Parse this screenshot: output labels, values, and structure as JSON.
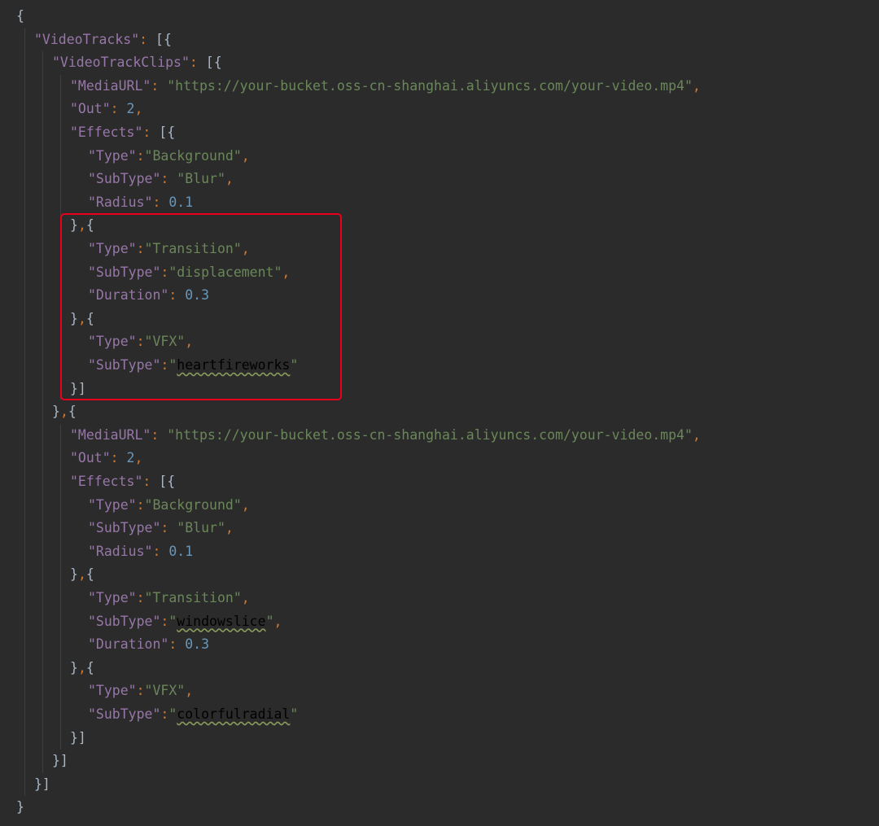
{
  "editor": {
    "highlight_color": "#e8001c",
    "colors": {
      "background": "#2b2b2b",
      "key": "#9876aa",
      "string": "#6a8759",
      "number": "#6897bb",
      "punctuation": "#cc7832",
      "bracket": "#a9b7c6"
    },
    "lines": [
      [
        [
          "brk",
          "{"
        ]
      ],
      [
        [
          "key",
          "\"VideoTracks\""
        ],
        [
          "pun",
          ":"
        ],
        [
          "brk",
          " [{"
        ]
      ],
      [
        [
          "key",
          "\"VideoTrackClips\""
        ],
        [
          "pun",
          ":"
        ],
        [
          "brk",
          " [{"
        ]
      ],
      [
        [
          "key",
          "\"MediaURL\""
        ],
        [
          "pun",
          ": "
        ],
        [
          "str",
          "\"https://your-bucket.oss-cn-shanghai.aliyuncs.com/your-video.mp4\""
        ],
        [
          "pun",
          ","
        ]
      ],
      [
        [
          "key",
          "\"Out\""
        ],
        [
          "pun",
          ": "
        ],
        [
          "num",
          "2"
        ],
        [
          "pun",
          ","
        ]
      ],
      [
        [
          "key",
          "\"Effects\""
        ],
        [
          "pun",
          ":"
        ],
        [
          "brk",
          " [{"
        ]
      ],
      [
        [
          "key",
          "\"Type\""
        ],
        [
          "pun",
          ":"
        ],
        [
          "str",
          "\"Background\""
        ],
        [
          "pun",
          ","
        ]
      ],
      [
        [
          "key",
          "\"SubType\""
        ],
        [
          "pun",
          ": "
        ],
        [
          "str",
          "\"Blur\""
        ],
        [
          "pun",
          ","
        ]
      ],
      [
        [
          "key",
          "\"Radius\""
        ],
        [
          "pun",
          ": "
        ],
        [
          "num",
          "0.1"
        ]
      ],
      [
        [
          "brk",
          "}"
        ],
        [
          "pun",
          ","
        ],
        [
          "brk",
          "{"
        ]
      ],
      [
        [
          "key",
          "\"Type\""
        ],
        [
          "pun",
          ":"
        ],
        [
          "str",
          "\"Transition\""
        ],
        [
          "pun",
          ","
        ]
      ],
      [
        [
          "key",
          "\"SubType\""
        ],
        [
          "pun",
          ":"
        ],
        [
          "str",
          "\"displacement\""
        ],
        [
          "pun",
          ","
        ]
      ],
      [
        [
          "key",
          "\"Duration\""
        ],
        [
          "pun",
          ": "
        ],
        [
          "num",
          "0.3"
        ]
      ],
      [
        [
          "brk",
          "}"
        ],
        [
          "pun",
          ","
        ],
        [
          "brk",
          "{"
        ]
      ],
      [
        [
          "key",
          "\"Type\""
        ],
        [
          "pun",
          ":"
        ],
        [
          "str",
          "\"VFX\""
        ],
        [
          "pun",
          ","
        ]
      ],
      [
        [
          "key",
          "\"SubType\""
        ],
        [
          "pun",
          ":"
        ],
        [
          "str",
          "\""
        ],
        [
          "typo",
          "heartfireworks"
        ],
        [
          "str",
          "\""
        ]
      ],
      [
        [
          "brk",
          "}]"
        ]
      ],
      [
        [
          "brk",
          "}"
        ],
        [
          "pun",
          ","
        ],
        [
          "brk",
          "{"
        ]
      ],
      [
        [
          "key",
          "\"MediaURL\""
        ],
        [
          "pun",
          ": "
        ],
        [
          "str",
          "\"https://your-bucket.oss-cn-shanghai.aliyuncs.com/your-video.mp4\""
        ],
        [
          "pun",
          ","
        ]
      ],
      [
        [
          "key",
          "\"Out\""
        ],
        [
          "pun",
          ": "
        ],
        [
          "num",
          "2"
        ],
        [
          "pun",
          ","
        ]
      ],
      [
        [
          "key",
          "\"Effects\""
        ],
        [
          "pun",
          ":"
        ],
        [
          "brk",
          " [{"
        ]
      ],
      [
        [
          "key",
          "\"Type\""
        ],
        [
          "pun",
          ":"
        ],
        [
          "str",
          "\"Background\""
        ],
        [
          "pun",
          ","
        ]
      ],
      [
        [
          "key",
          "\"SubType\""
        ],
        [
          "pun",
          ": "
        ],
        [
          "str",
          "\"Blur\""
        ],
        [
          "pun",
          ","
        ]
      ],
      [
        [
          "key",
          "\"Radius\""
        ],
        [
          "pun",
          ": "
        ],
        [
          "num",
          "0.1"
        ]
      ],
      [
        [
          "brk",
          "}"
        ],
        [
          "pun",
          ","
        ],
        [
          "brk",
          "{"
        ]
      ],
      [
        [
          "key",
          "\"Type\""
        ],
        [
          "pun",
          ":"
        ],
        [
          "str",
          "\"Transition\""
        ],
        [
          "pun",
          ","
        ]
      ],
      [
        [
          "key",
          "\"SubType\""
        ],
        [
          "pun",
          ":"
        ],
        [
          "str",
          "\""
        ],
        [
          "typo",
          "windowslice"
        ],
        [
          "str",
          "\""
        ],
        [
          "pun",
          ","
        ]
      ],
      [
        [
          "key",
          "\"Duration\""
        ],
        [
          "pun",
          ": "
        ],
        [
          "num",
          "0.3"
        ]
      ],
      [
        [
          "brk",
          "}"
        ],
        [
          "pun",
          ","
        ],
        [
          "brk",
          "{"
        ]
      ],
      [
        [
          "key",
          "\"Type\""
        ],
        [
          "pun",
          ":"
        ],
        [
          "str",
          "\"VFX\""
        ],
        [
          "pun",
          ","
        ]
      ],
      [
        [
          "key",
          "\"SubType\""
        ],
        [
          "pun",
          ":"
        ],
        [
          "str",
          "\""
        ],
        [
          "typo",
          "colorfulradial"
        ],
        [
          "str",
          "\""
        ]
      ],
      [
        [
          "brk",
          "}]"
        ]
      ],
      [
        [
          "brk",
          "}]"
        ]
      ],
      [
        [
          "brk",
          "}]"
        ]
      ],
      [
        [
          "brk",
          "}"
        ]
      ]
    ]
  }
}
